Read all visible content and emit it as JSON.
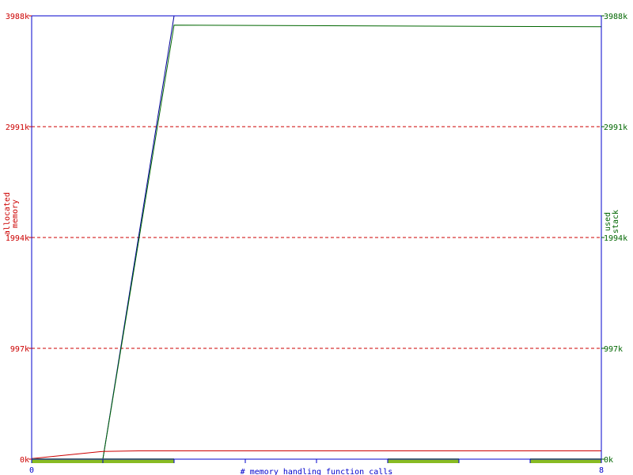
{
  "chart_data": {
    "type": "line",
    "xlabel": "# memory handling function calls",
    "ylabel_left": [
      "allocated",
      "memory"
    ],
    "ylabel_right": [
      "used",
      "stack"
    ],
    "xlim": [
      0,
      8
    ],
    "ylim": [
      0,
      3988
    ],
    "x_ticks": [
      "0",
      "8"
    ],
    "left_ticks": [
      {
        "value": 0,
        "label": "0k"
      },
      {
        "value": 997,
        "label": "997k"
      },
      {
        "value": 1994,
        "label": "1994k"
      },
      {
        "value": 2991,
        "label": "2991k"
      },
      {
        "value": 3988,
        "label": "3988k"
      }
    ],
    "right_ticks": [
      {
        "value": 0,
        "label": "0k"
      },
      {
        "value": 997,
        "label": "997k"
      },
      {
        "value": 1994,
        "label": "1994k"
      },
      {
        "value": 2991,
        "label": "2991k"
      },
      {
        "value": 3988,
        "label": "3988k"
      }
    ],
    "grid": true,
    "colors": {
      "left_axis": "#cc0000",
      "right_axis": "#006600",
      "frame": "#0000cc",
      "grid": "#cc0000",
      "activity": "#88bb22"
    },
    "series": [
      {
        "key": "total",
        "color": "#000099",
        "points": [
          [
            0,
            0
          ],
          [
            1,
            0
          ],
          [
            2,
            3988
          ],
          [
            8,
            3988
          ]
        ]
      },
      {
        "key": "stack",
        "color": "#006600",
        "points": [
          [
            0,
            0
          ],
          [
            1,
            0
          ],
          [
            2,
            3905
          ],
          [
            8,
            3890
          ]
        ]
      },
      {
        "key": "allocated",
        "color": "#cc0000",
        "points": [
          [
            0,
            5
          ],
          [
            1,
            70
          ],
          [
            1.5,
            75
          ],
          [
            8,
            75
          ]
        ]
      }
    ],
    "activity_bars": [
      [
        0,
        2
      ],
      [
        5,
        6
      ],
      [
        7,
        8
      ]
    ]
  }
}
